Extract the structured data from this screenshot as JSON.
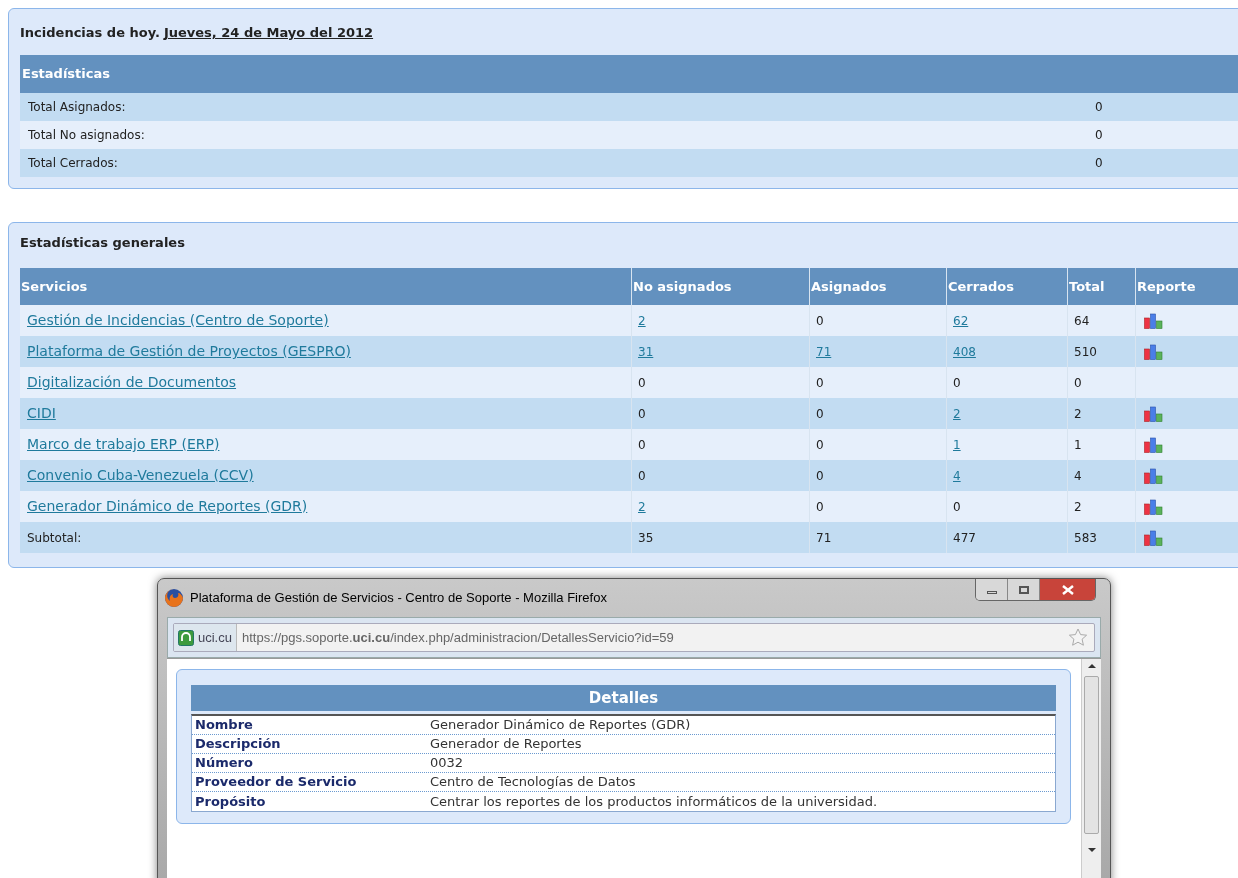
{
  "today_panel": {
    "title": "Incidencias de hoy.",
    "date": "Jueves, 24 de Mayo del 2012",
    "table_header": "Estadísticas",
    "rows": [
      {
        "label": "Total Asignados:",
        "value": "0"
      },
      {
        "label": "Total No asignados:",
        "value": "0"
      },
      {
        "label": "Total Cerrados:",
        "value": "0"
      }
    ]
  },
  "general_panel": {
    "title": "Estadísticas generales",
    "columns": [
      "Servicios",
      "No asignados",
      "Asignados",
      "Cerrados",
      "Total",
      "Reporte"
    ],
    "rows": [
      {
        "cells": [
          {
            "text": "Gestión de Incidencias (Centro de Soporte)",
            "link": true
          },
          {
            "text": "2",
            "link": true
          },
          {
            "text": "0",
            "link": false
          },
          {
            "text": "62",
            "link": true
          },
          {
            "text": "64",
            "link": false
          }
        ],
        "report": true
      },
      {
        "cells": [
          {
            "text": "Plataforma de Gestión de Proyectos (GESPRO)",
            "link": true
          },
          {
            "text": "31",
            "link": true
          },
          {
            "text": "71",
            "link": true
          },
          {
            "text": "408",
            "link": true
          },
          {
            "text": "510",
            "link": false
          }
        ],
        "report": true
      },
      {
        "cells": [
          {
            "text": "Digitalización de Documentos",
            "link": true
          },
          {
            "text": "0",
            "link": false
          },
          {
            "text": "0",
            "link": false
          },
          {
            "text": "0",
            "link": false
          },
          {
            "text": "0",
            "link": false
          }
        ],
        "report": false
      },
      {
        "cells": [
          {
            "text": "CIDI",
            "link": true
          },
          {
            "text": "0",
            "link": false
          },
          {
            "text": "0",
            "link": false
          },
          {
            "text": "2",
            "link": true
          },
          {
            "text": "2",
            "link": false
          }
        ],
        "report": true
      },
      {
        "cells": [
          {
            "text": "Marco de trabajo ERP (ERP)",
            "link": true
          },
          {
            "text": "0",
            "link": false
          },
          {
            "text": "0",
            "link": false
          },
          {
            "text": "1",
            "link": true
          },
          {
            "text": "1",
            "link": false
          }
        ],
        "report": true
      },
      {
        "cells": [
          {
            "text": "Convenio Cuba-Venezuela (CCV)",
            "link": true
          },
          {
            "text": "0",
            "link": false
          },
          {
            "text": "0",
            "link": false
          },
          {
            "text": "4",
            "link": true
          },
          {
            "text": "4",
            "link": false
          }
        ],
        "report": true
      },
      {
        "cells": [
          {
            "text": "Generador Dinámico de Reportes (GDR)",
            "link": true
          },
          {
            "text": "2",
            "link": true
          },
          {
            "text": "0",
            "link": false
          },
          {
            "text": "0",
            "link": false
          },
          {
            "text": "2",
            "link": false
          }
        ],
        "report": true
      },
      {
        "cells": [
          {
            "text": "Subtotal:",
            "link": false
          },
          {
            "text": "35",
            "link": false
          },
          {
            "text": "71",
            "link": false
          },
          {
            "text": "477",
            "link": false
          },
          {
            "text": "583",
            "link": false
          }
        ],
        "report": true
      }
    ]
  },
  "popup": {
    "window_title": "Plataforma de Gestión de Servicios - Centro de Soporte - Mozilla Firefox",
    "identity": "uci.cu",
    "url": "https://pgs.soporte.**uci.cu**/index.php/administracion/DetallesServicio?id=59",
    "details_header": "Detalles",
    "details": [
      {
        "label": "Nombre",
        "value": "Generador Dinámico de Reportes (GDR)"
      },
      {
        "label": "Descripción",
        "value": "Generador de Reportes"
      },
      {
        "label": "Número",
        "value": "0032"
      },
      {
        "label": "Proveedor de Servicio",
        "value": "Centro de Tecnologías de Datos"
      },
      {
        "label": "Propósito",
        "value": "Centrar los reportes de los productos informáticos de la universidad."
      }
    ]
  }
}
